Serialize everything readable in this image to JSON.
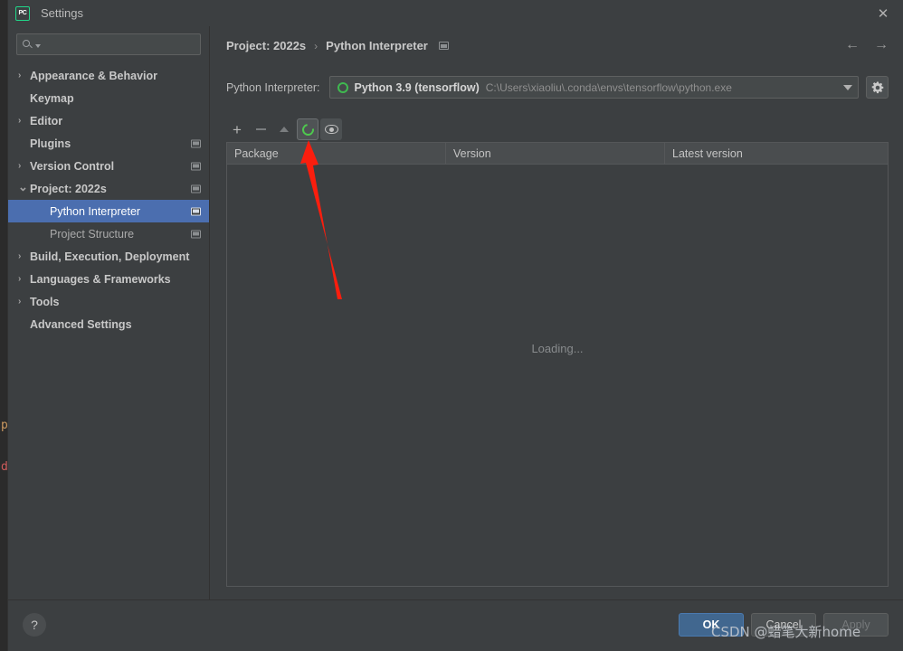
{
  "window": {
    "title": "Settings",
    "app_icon": "pycharm-icon",
    "app_icon_text": "PC",
    "close_icon": "close-icon",
    "accent_green": "#21d789",
    "selection_blue": "#4b6eaf",
    "primary_button_blue": "#41678f"
  },
  "sidebar": {
    "search": {
      "value": "",
      "placeholder": "",
      "icon": "search-icon"
    },
    "items": [
      {
        "label": "Appearance & Behavior",
        "expandable": true,
        "expanded": false,
        "child": false,
        "bold": true,
        "modified_icon": false,
        "selected": false
      },
      {
        "label": "Keymap",
        "expandable": false,
        "expanded": false,
        "child": false,
        "bold": true,
        "modified_icon": false,
        "selected": false
      },
      {
        "label": "Editor",
        "expandable": true,
        "expanded": false,
        "child": false,
        "bold": true,
        "modified_icon": false,
        "selected": false
      },
      {
        "label": "Plugins",
        "expandable": false,
        "expanded": false,
        "child": false,
        "bold": true,
        "modified_icon": true,
        "selected": false
      },
      {
        "label": "Version Control",
        "expandable": true,
        "expanded": false,
        "child": false,
        "bold": true,
        "modified_icon": true,
        "selected": false
      },
      {
        "label": "Project: 2022s",
        "expandable": true,
        "expanded": true,
        "child": false,
        "bold": true,
        "modified_icon": true,
        "selected": false
      },
      {
        "label": "Python Interpreter",
        "expandable": false,
        "expanded": false,
        "child": true,
        "bold": false,
        "modified_icon": true,
        "selected": true
      },
      {
        "label": "Project Structure",
        "expandable": false,
        "expanded": false,
        "child": true,
        "bold": false,
        "modified_icon": true,
        "selected": false
      },
      {
        "label": "Build, Execution, Deployment",
        "expandable": true,
        "expanded": false,
        "child": false,
        "bold": true,
        "modified_icon": false,
        "selected": false
      },
      {
        "label": "Languages & Frameworks",
        "expandable": true,
        "expanded": false,
        "child": false,
        "bold": true,
        "modified_icon": false,
        "selected": false
      },
      {
        "label": "Tools",
        "expandable": true,
        "expanded": false,
        "child": false,
        "bold": true,
        "modified_icon": false,
        "selected": false
      },
      {
        "label": "Advanced Settings",
        "expandable": false,
        "expanded": false,
        "child": false,
        "bold": true,
        "modified_icon": false,
        "selected": false
      }
    ]
  },
  "content": {
    "breadcrumb": {
      "root": "Project: 2022s",
      "separator": "›",
      "leaf": "Python Interpreter"
    },
    "nav": {
      "back_icon": "arrow-left-icon",
      "forward_icon": "arrow-right-icon",
      "back_glyph": "←",
      "forward_glyph": "→"
    },
    "interpreter": {
      "label": "Python Interpreter:",
      "name": "Python 3.9 (tensorflow)",
      "path": "C:\\Users\\xiaoliu\\.conda\\envs\\tensorflow\\python.exe",
      "status_icon": "python-env-ring-icon",
      "gear_icon": "gear-icon"
    },
    "packages": {
      "toolbar": [
        {
          "name": "add-package-button",
          "glyph": "+",
          "kind": "plus",
          "active": false
        },
        {
          "name": "remove-package-button",
          "glyph": "−",
          "kind": "minus",
          "active": false
        },
        {
          "name": "upgrade-package-button",
          "glyph": "▲",
          "kind": "up",
          "active": false
        },
        {
          "name": "refresh-packages-button",
          "glyph": "○",
          "kind": "ring",
          "active": true
        },
        {
          "name": "show-early-releases-button",
          "glyph": "◉",
          "kind": "eye",
          "active": false
        }
      ],
      "columns": [
        "Package",
        "Version",
        "Latest version"
      ],
      "rows": [],
      "empty_state": "Loading..."
    }
  },
  "footer": {
    "help_label": "?",
    "buttons": [
      {
        "label": "OK",
        "style": "primary",
        "enabled": true
      },
      {
        "label": "Cancel",
        "style": "normal",
        "enabled": true
      },
      {
        "label": "Apply",
        "style": "disabled",
        "enabled": false
      }
    ]
  },
  "annotation": {
    "arrow_color": "#fa1e0e",
    "arrow_target": "refresh-packages-button"
  },
  "watermark": {
    "text": "CSDN @蜡笔大新home"
  },
  "background_editor": {
    "fragment_1": "p",
    "fragment_2": "d"
  }
}
